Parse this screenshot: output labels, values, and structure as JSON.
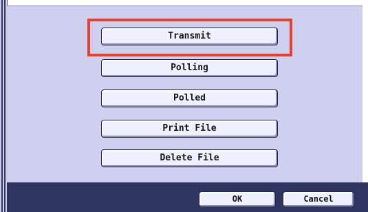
{
  "menu": {
    "transmit_label": "Transmit",
    "polling_label": "Polling",
    "polled_label": "Polled",
    "print_file_label": "Print File",
    "delete_file_label": "Delete File"
  },
  "footer": {
    "ok_label": "OK",
    "cancel_label": "Cancel"
  },
  "colors": {
    "panel_bg": "#cfd0ef",
    "footer_bg": "#2f3561",
    "highlight": "#e8402a",
    "button_bg": "#eef0ff"
  }
}
